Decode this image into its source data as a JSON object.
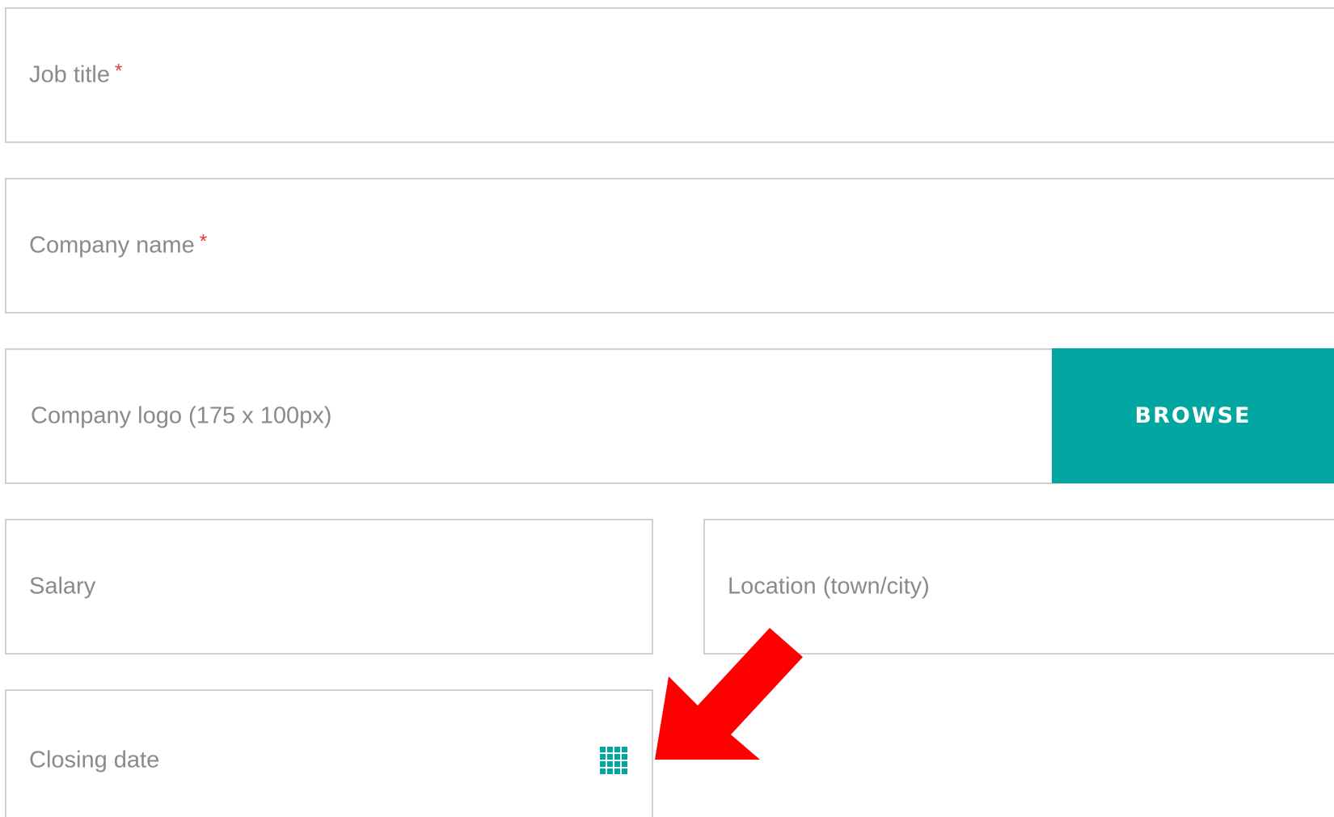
{
  "form": {
    "job_title": {
      "label": "Job title",
      "required_mark": "*"
    },
    "company_name": {
      "label": "Company name",
      "required_mark": "*"
    },
    "company_logo": {
      "label": "Company logo (175 x 100px)",
      "button_label": "BROWSE"
    },
    "salary": {
      "label": "Salary"
    },
    "location": {
      "label": "Location (town/city)"
    },
    "closing_date": {
      "label": "Closing date",
      "icon": "calendar-grid-icon"
    }
  },
  "colors": {
    "accent": "#00a69f",
    "required": "#e53935",
    "border": "#cfcfcf",
    "label_text": "#8a8a8a",
    "annotation_arrow": "#ff0000"
  }
}
